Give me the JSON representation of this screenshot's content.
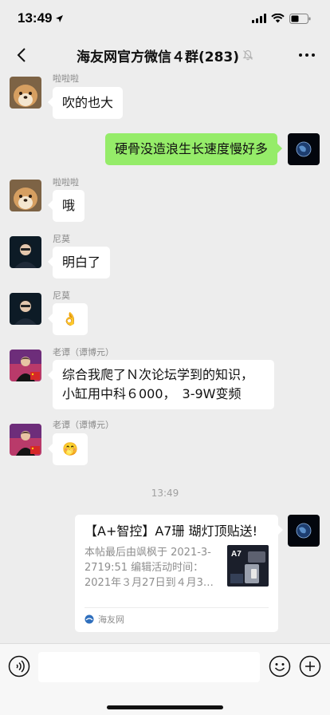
{
  "status_bar": {
    "time": "13:49"
  },
  "header": {
    "title": "海友网官方微信４群(283)"
  },
  "messages": [
    {
      "sender": "啦啦啦",
      "text": "吹的也大"
    },
    {
      "text": "硬骨没造浪生长速度慢好多"
    },
    {
      "sender": "啦啦啦",
      "text": "哦"
    },
    {
      "sender": "尼莫",
      "text": "明白了"
    },
    {
      "sender": "尼莫",
      "text": "👌"
    },
    {
      "sender": "老谭（谭博元）",
      "line1": "综合我爬了Ｎ次论坛学到的知识，",
      "line2": "小缸用中科６000，　3-9W变频"
    },
    {
      "sender": "老谭（谭博元）",
      "text": "🤭"
    }
  ],
  "timestamp": "13:49",
  "link_card": {
    "title": "【A+智控】A7珊 瑚灯顶贴送!",
    "desc": "本帖最后由飒枫于 2021-3-2719:51 编辑活动时间：2021年３月27日到４月3…",
    "source": "海友网",
    "thumb_label": "A7"
  },
  "colors": {
    "background": "#ededed",
    "own_bubble": "#95ec69",
    "other_bubble": "#ffffff"
  }
}
